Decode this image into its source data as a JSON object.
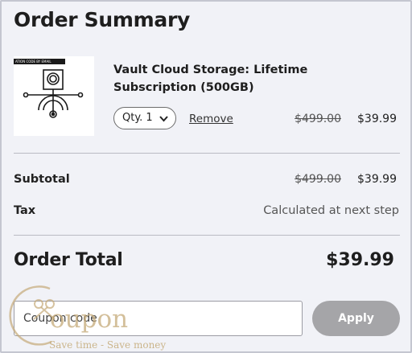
{
  "header": {
    "title": "Order Summary"
  },
  "item": {
    "image_banner": "ATION CODE BY EMAIL",
    "name": "Vault Cloud Storage: Lifetime Subscription (500GB)",
    "qty_label": "Qty. 1",
    "remove_label": "Remove",
    "original_price": "$499.00",
    "price": "$39.99"
  },
  "summary": {
    "subtotal_label": "Subtotal",
    "subtotal_original": "$499.00",
    "subtotal_price": "$39.99",
    "tax_label": "Tax",
    "tax_value": "Calculated at next step",
    "total_label": "Order Total",
    "total_value": "$39.99"
  },
  "coupon": {
    "placeholder": "Coupon code",
    "apply_label": "Apply"
  },
  "watermark": {
    "word": "oupon",
    "tagline": "Save time - Save money"
  },
  "colors": {
    "background": "#f1f2f7",
    "apply_button": "#a5a5a8",
    "watermark": "#c4aa78"
  }
}
